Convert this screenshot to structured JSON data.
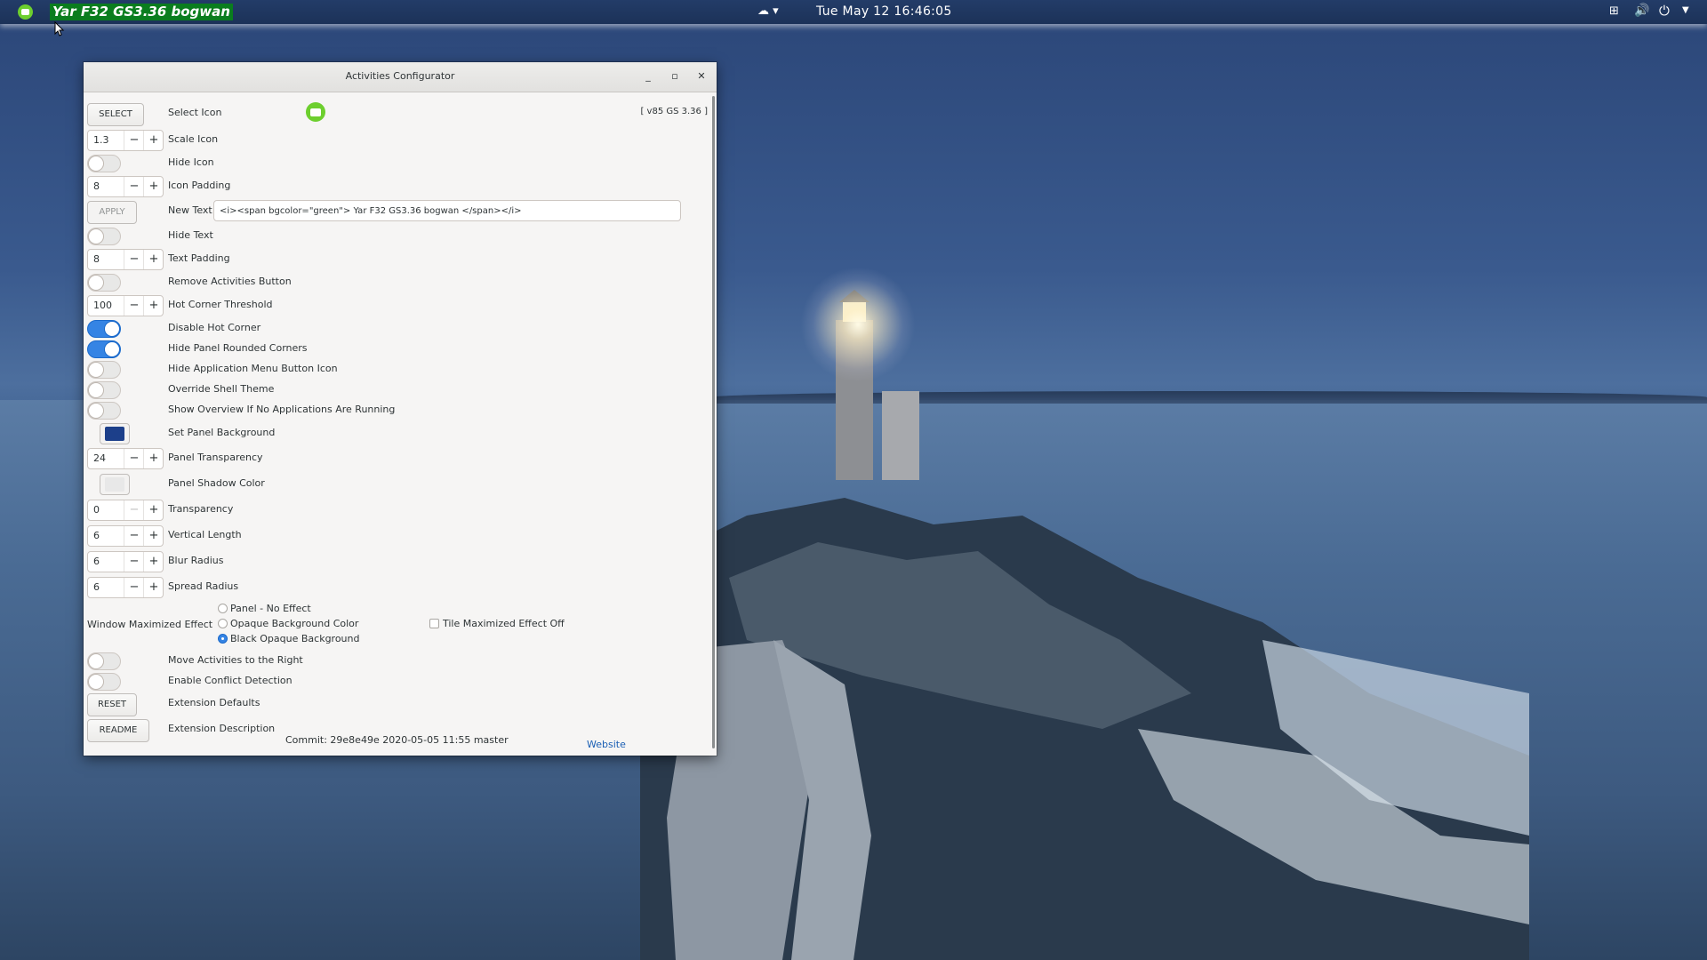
{
  "top_panel": {
    "activities_text": "Yar F32 GS3.36 bogwan",
    "clock": "Tue May 12  16:46:05",
    "weather_icon": "weather-icon",
    "tray": [
      "network-icon",
      "volume-icon",
      "power-icon",
      "menu-arrow-icon"
    ]
  },
  "window": {
    "title": "Activities Configurator",
    "version": "[ v85 GS 3.36 ]",
    "select_button": "SELECT",
    "select_icon_label": "Select Icon",
    "scale_icon": {
      "value": "1.3",
      "label": "Scale Icon"
    },
    "hide_icon": {
      "label": "Hide Icon",
      "on": false
    },
    "icon_padding": {
      "value": "8",
      "label": "Icon Padding"
    },
    "apply_button": "APPLY",
    "new_text_label": "New Text",
    "new_text_value": "<i><span bgcolor=\"green\"> Yar  F32 GS3.36 bogwan  </span></i>",
    "hide_text": {
      "label": "Hide Text",
      "on": false
    },
    "text_padding": {
      "value": "8",
      "label": "Text Padding"
    },
    "remove_activities": {
      "label": "Remove Activities Button",
      "on": false
    },
    "hot_corner_threshold": {
      "value": "100",
      "label": "Hot Corner Threshold"
    },
    "disable_hot_corner": {
      "label": "Disable Hot Corner",
      "on": true
    },
    "hide_panel_corners": {
      "label": "Hide Panel Rounded Corners",
      "on": true
    },
    "hide_app_menu_icon": {
      "label": "Hide Application Menu Button Icon",
      "on": false
    },
    "override_shell_theme": {
      "label": "Override Shell Theme",
      "on": false
    },
    "show_overview": {
      "label": "Show Overview If No Applications Are Running",
      "on": false
    },
    "panel_background": {
      "label": "Set Panel Background",
      "color": "#1c3f8a"
    },
    "panel_transparency": {
      "value": "24",
      "label": "Panel Transparency"
    },
    "panel_shadow_color": {
      "label": "Panel Shadow Color",
      "color": "#e8e8e8"
    },
    "transparency": {
      "value": "0",
      "label": "Transparency"
    },
    "vertical_length": {
      "value": "6",
      "label": "Vertical Length"
    },
    "blur_radius": {
      "value": "6",
      "label": "Blur Radius"
    },
    "spread_radius": {
      "value": "6",
      "label": "Spread Radius"
    },
    "maximized_effect": {
      "label": "Window Maximized Effect",
      "options": [
        "Panel - No Effect",
        "Opaque Background Color",
        "Black Opaque Background"
      ],
      "selected": "Black Opaque Background",
      "tile_label": "Tile Maximized Effect Off"
    },
    "move_activities_right": {
      "label": "Move Activities to the Right",
      "on": false
    },
    "conflict_detection": {
      "label": "Enable Conflict Detection",
      "on": false
    },
    "reset_button": "RESET",
    "reset_label": "Extension Defaults",
    "readme_button": "README",
    "readme_label": "Extension Description",
    "commit": "Commit: 29e8e49e 2020-05-05 11:55 master",
    "website": "Website"
  }
}
